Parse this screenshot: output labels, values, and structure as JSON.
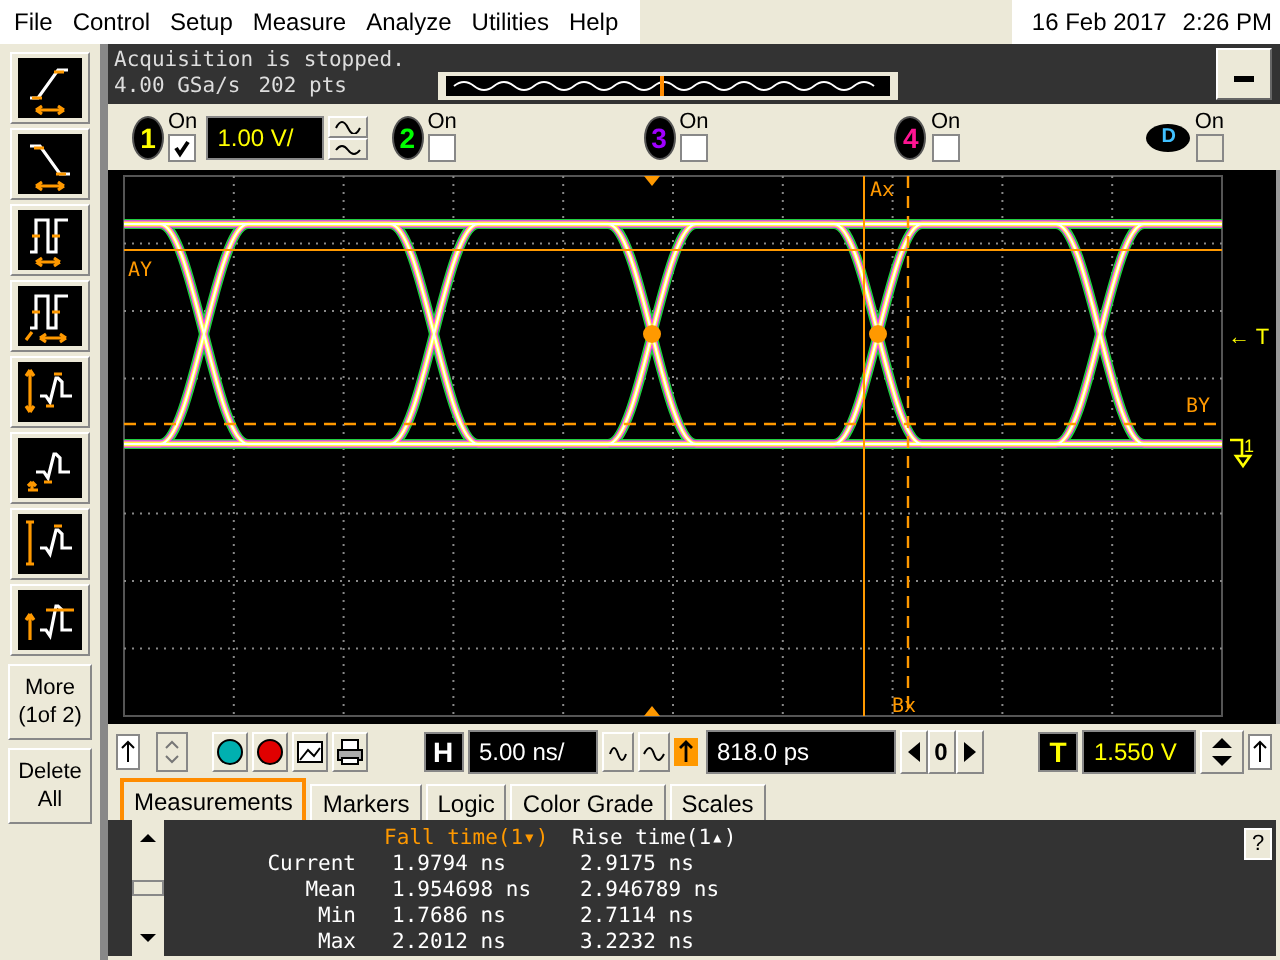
{
  "menu": [
    "File",
    "Control",
    "Setup",
    "Measure",
    "Analyze",
    "Utilities",
    "Help"
  ],
  "datetime": {
    "date": "16 Feb 2017",
    "time": "2:26 PM"
  },
  "status": {
    "message": "Acquisition is stopped.",
    "sample_rate": "4.00 GSa/s",
    "points": "202 pts"
  },
  "channels": [
    {
      "number": "1",
      "label": "On",
      "checked": true,
      "color": "#ffff00"
    },
    {
      "number": "2",
      "label": "On",
      "checked": false,
      "color": "#00ff00"
    },
    {
      "number": "3",
      "label": "On",
      "checked": false,
      "color": "#a000ff"
    },
    {
      "number": "4",
      "label": "On",
      "checked": false,
      "color": "#ff1493"
    }
  ],
  "channel_scale": "1.00 V/",
  "digital": {
    "letter": "D",
    "label": "On",
    "checked": false
  },
  "cursors": {
    "ay": "AY",
    "ax": "Ax",
    "bx": "Bx",
    "by": "BY",
    "trigger": "← T",
    "ground": "1"
  },
  "sidebar": {
    "more": "More (1of 2)",
    "delete": "Delete All"
  },
  "timebase": {
    "h": "H",
    "scale": "5.00 ns/",
    "delay": "818.0 ps",
    "zero": "0",
    "t": "T",
    "trigger_level": "1.550 V"
  },
  "tabs": [
    {
      "label": "Measurements",
      "selected": true
    },
    {
      "label": "Markers",
      "selected": false
    },
    {
      "label": "Logic",
      "selected": false
    },
    {
      "label": "Color Grade",
      "selected": false
    },
    {
      "label": "Scales",
      "selected": false
    }
  ],
  "measurements": {
    "columns": [
      {
        "label": "Fall time(1▾)",
        "selected": true
      },
      {
        "label": "Rise time(1▴)",
        "selected": false
      }
    ],
    "rows": [
      {
        "label": "Current",
        "values": [
          "1.9794 ns",
          "2.9175 ns"
        ]
      },
      {
        "label": "Mean",
        "values": [
          "1.954698 ns",
          "2.946789 ns"
        ]
      },
      {
        "label": "Min",
        "values": [
          "1.7686 ns",
          "2.7114 ns"
        ]
      },
      {
        "label": "Max",
        "values": [
          "2.2012 ns",
          "3.2232 ns"
        ]
      }
    ],
    "help": "?"
  }
}
